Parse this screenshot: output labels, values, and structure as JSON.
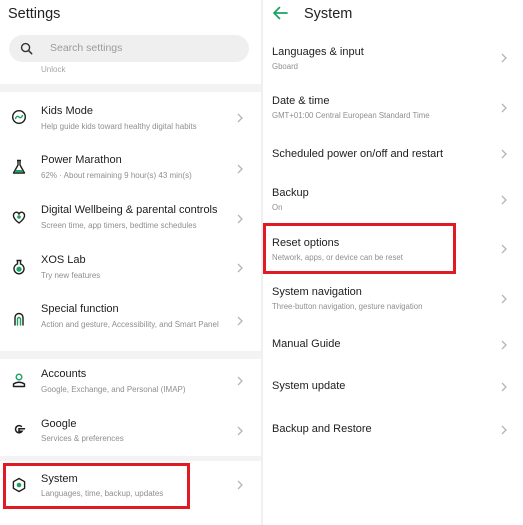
{
  "left": {
    "title": "Settings",
    "search_placeholder": "Search settings",
    "peek_text": "Unlock",
    "items": [
      {
        "label": "Kids Mode",
        "sub": "Help guide kids toward healthy digital habits"
      },
      {
        "label": "Power Marathon",
        "sub": "62% · About remaining 9 hour(s)  43 min(s)"
      },
      {
        "label": "Digital Wellbeing & parental controls",
        "sub": "Screen time, app timers, bedtime schedules"
      },
      {
        "label": "XOS Lab",
        "sub": "Try new features"
      },
      {
        "label": "Special function",
        "sub": "Action and gesture, Accessibility, and Smart Panel"
      },
      {
        "label": "Accounts",
        "sub": "Google, Exchange, and Personal (IMAP)"
      },
      {
        "label": "Google",
        "sub": "Services & preferences"
      },
      {
        "label": "System",
        "sub": "Languages, time, backup, updates"
      }
    ]
  },
  "right": {
    "title": "System",
    "items": [
      {
        "label": "Languages & input",
        "sub": "Gboard"
      },
      {
        "label": "Date & time",
        "sub": "GMT+01:00 Central European Standard Time"
      },
      {
        "label": "Scheduled power on/off and restart",
        "sub": ""
      },
      {
        "label": "Backup",
        "sub": "On"
      },
      {
        "label": "Reset options",
        "sub": "Network, apps, or device can be reset"
      },
      {
        "label": "System navigation",
        "sub": "Three-button navigation, gesture navigation"
      },
      {
        "label": "Manual Guide",
        "sub": ""
      },
      {
        "label": "System update",
        "sub": ""
      },
      {
        "label": "Backup and Restore",
        "sub": ""
      }
    ]
  },
  "icons": {
    "left_items": [
      "kids-mode-icon",
      "flask-icon",
      "wellbeing-heart-icon",
      "lab-flask-icon",
      "gesture-hand-icon",
      "account-person-icon",
      "google-g-icon",
      "system-gear-icon"
    ],
    "chevron": "chevron-right-icon",
    "back": "back-arrow-icon",
    "search": "search-icon"
  },
  "colors": {
    "accent": "#1aa260",
    "highlight": "#e01b24",
    "subtext": "#8f8f8f"
  }
}
